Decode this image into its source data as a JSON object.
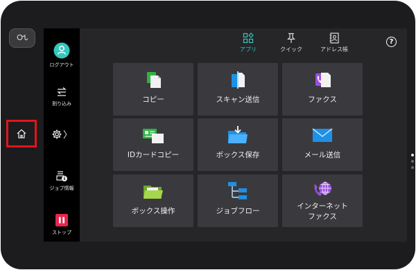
{
  "device": {
    "power_label": "ᏅᏓ",
    "home_button": "home-icon"
  },
  "side_panel": {
    "logout": {
      "label": "ログアウト",
      "icon": "user-icon"
    },
    "interrupt": {
      "label": "割り込み",
      "icon": "interrupt-icon"
    },
    "settings": {
      "icon": "gear-icon",
      "chevron": "〉"
    },
    "job_status": {
      "label": "ジョブ情報",
      "icon": "job-info-icon"
    },
    "stop": {
      "label": "ストップ",
      "icon": "stop-icon"
    }
  },
  "tabs": [
    {
      "label": "アプリ",
      "icon": "apps-icon",
      "active": true
    },
    {
      "label": "クイック",
      "icon": "pin-icon",
      "active": false
    },
    {
      "label": "アドレス帳",
      "icon": "address-book-icon",
      "active": false
    }
  ],
  "help": {
    "label": "?"
  },
  "tiles": [
    {
      "label": "コピー",
      "icon": "copy-icon"
    },
    {
      "label": "スキャン送信",
      "icon": "scan-icon"
    },
    {
      "label": "ファクス",
      "icon": "fax-icon"
    },
    {
      "label": "IDカードコピー",
      "icon": "id-card-icon"
    },
    {
      "label": "ボックス保存",
      "icon": "box-save-icon"
    },
    {
      "label": "メール送信",
      "icon": "mail-icon"
    },
    {
      "label": "ボックス操作",
      "icon": "box-folder-icon"
    },
    {
      "label": "ジョブフロー",
      "icon": "job-flow-icon"
    },
    {
      "label": "インターネット\nファクス",
      "icon": "internet-fax-icon"
    }
  ],
  "page_indicator": {
    "total": 3,
    "current": 1
  },
  "colors": {
    "accent": "#34c8bf",
    "stop": "#e8264e",
    "highlight": "#e0161b"
  }
}
